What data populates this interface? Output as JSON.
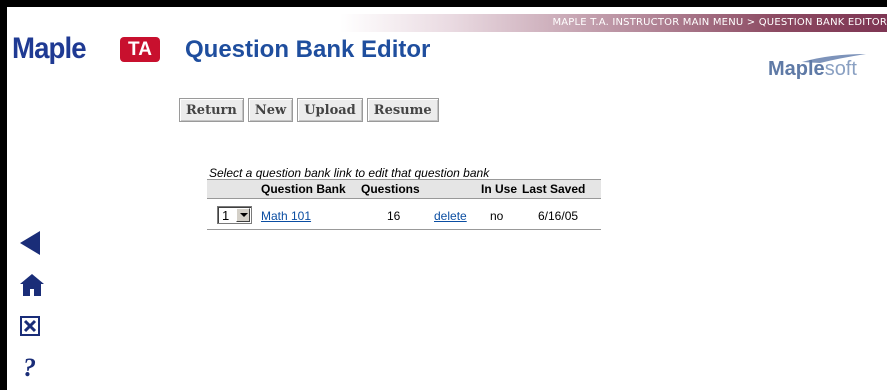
{
  "breadcrumb": "MAPLE T.A. INSTRUCTOR MAIN MENU > QUESTION BANK EDITOR",
  "logo": {
    "maple": "Maple",
    "ta": "TA"
  },
  "page_title": "Question Bank Editor",
  "maplesoft_logo": {
    "maple": "Maple",
    "soft": "soft"
  },
  "toolbar": {
    "return_label": "Return",
    "new_label": "New",
    "upload_label": "Upload",
    "resume_label": "Resume"
  },
  "table": {
    "caption": "Select a question bank link to edit that question bank",
    "headers": {
      "bank": "Question Bank",
      "questions": "Questions",
      "in_use": "In Use",
      "last_saved": "Last Saved"
    },
    "rows": [
      {
        "order": "1",
        "bank": "Math 101",
        "questions": "16",
        "action": "delete",
        "in_use": "no",
        "last_saved": "6/16/05"
      }
    ]
  },
  "nav_icons": [
    "back-arrow-icon",
    "home-icon",
    "close-icon",
    "help-icon"
  ],
  "colors": {
    "title_blue": "#1f4e9e",
    "logo_blue": "#1f3a93",
    "logo_red": "#c8102e",
    "link_blue": "#0b4ea2",
    "nav_blue": "#1a2d78"
  }
}
